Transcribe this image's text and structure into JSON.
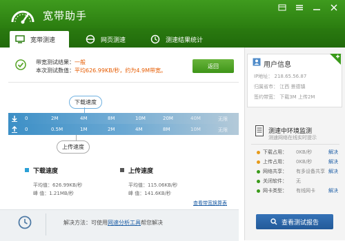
{
  "app": {
    "title": "宽带助手"
  },
  "tabs": [
    {
      "label": "宽带测速",
      "icon": "monitor-icon",
      "active": true
    },
    {
      "label": "网页测速",
      "icon": "ie-icon",
      "active": false
    },
    {
      "label": "测速结果统计",
      "icon": "clock-icon",
      "active": false
    }
  ],
  "result": {
    "line1_label": "带宽测试结果：",
    "line1_value": "一般",
    "line2_label": "本次测试数值：",
    "line2_value": "平均626.99KB/秒，约为4.9M带宽。",
    "retest_label": "返回"
  },
  "speedbar": {
    "download_bubble": "下载速度",
    "upload_bubble": "上传速度",
    "download_ticks": [
      "0",
      "2M",
      "4M",
      "8M",
      "10M",
      "20M",
      "40M",
      "无限"
    ],
    "upload_ticks": [
      "0",
      "0.5M",
      "1M",
      "2M",
      "4M",
      "8M",
      "10M",
      "无限"
    ]
  },
  "stats": {
    "download": {
      "title": "下载速度",
      "avg_label": "平均值：",
      "avg_value": "626.99KB/秒",
      "peak_label": "峰  值：",
      "peak_value": "1.21MB/秒",
      "color": "#2aa0d6"
    },
    "upload": {
      "title": "上传速度",
      "avg_label": "平均值：",
      "avg_value": "115.06KB/秒",
      "peak_label": "峰  值：",
      "peak_value": "141.6KB/秒",
      "color": "#555555"
    },
    "link": "查看带宽换算表"
  },
  "footer": {
    "prefix": "解决方法：可使用",
    "link": "网速分析工具",
    "suffix": "帮您解决"
  },
  "user_info": {
    "title": "用户信息",
    "ip": "IP地址：  218.65.56.87",
    "location": "归属省市：  江西  景德镇",
    "contract": "签约带宽：  下载3M  上传2M"
  },
  "monitor": {
    "title": "测速中环境监测",
    "subtitle": "测速网络在线实时提示",
    "rows": [
      {
        "label": "下载占用：",
        "value": "0KB/秒",
        "action": "解决",
        "color": "#e69a1a"
      },
      {
        "label": "上传占用：",
        "value": "0KB/秒",
        "action": "解决",
        "color": "#e69a1a"
      },
      {
        "label": "网络共享：",
        "value": "有多设备共享",
        "action": "解决",
        "color": "#3a9a1a"
      },
      {
        "label": "关闭软件：",
        "value": "无",
        "action": "",
        "color": "#3a9a1a"
      },
      {
        "label": "网卡类型：",
        "value": "有线网卡",
        "action": "解决",
        "color": "#3a9a1a"
      }
    ]
  },
  "report_button": "查看测试报告"
}
